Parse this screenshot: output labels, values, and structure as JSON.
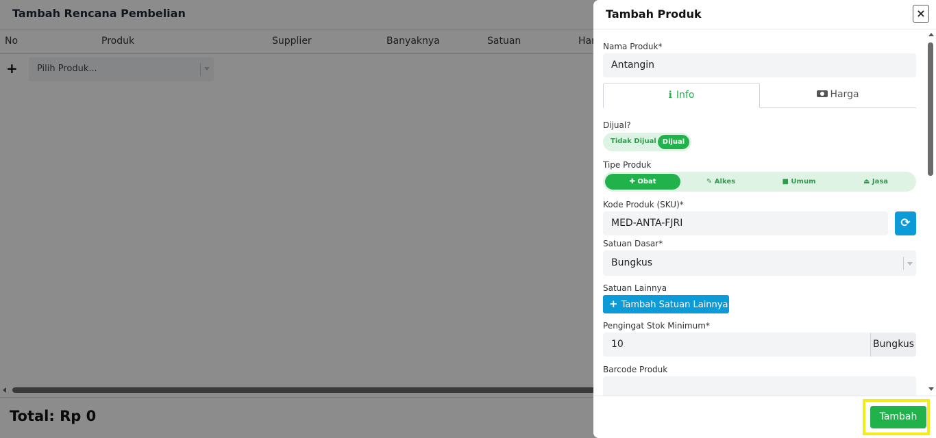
{
  "background": {
    "title": "Tambah Rencana Pembelian",
    "table_headers": [
      "No",
      "Produk",
      "Supplier",
      "Banyaknya",
      "Satuan",
      "Har"
    ],
    "product_select_placeholder": "Pilih Produk...",
    "total_label": "Total: Rp 0"
  },
  "drawer": {
    "title": "Tambah Produk",
    "close_label": "×",
    "nama_produk": {
      "label": "Nama Produk*",
      "value": "Antangin"
    },
    "tabs": [
      {
        "label": "Info",
        "icon": "info-icon"
      },
      {
        "label": "Harga",
        "icon": "money-icon"
      }
    ],
    "dijual": {
      "label": "Dijual?",
      "options": [
        "Tidak Dijual",
        "Dijual"
      ],
      "selected": "Dijual"
    },
    "tipe_produk": {
      "label": "Tipe Produk",
      "options": [
        {
          "label": "Obat",
          "icon": "pills-icon"
        },
        {
          "label": "Alkes",
          "icon": "pencil-icon"
        },
        {
          "label": "Umum",
          "icon": "box-icon"
        },
        {
          "label": "Jasa",
          "icon": "eject-icon"
        }
      ],
      "selected": "Obat"
    },
    "kode_produk": {
      "label": "Kode Produk (SKU)*",
      "value": "MED-ANTA-FJRI"
    },
    "satuan_dasar": {
      "label": "Satuan Dasar*",
      "value": "Bungkus"
    },
    "satuan_lainnya": {
      "label": "Satuan Lainnya",
      "button_label": "Tambah Satuan Lainnya"
    },
    "stok_minimum": {
      "label": "Pengingat Stok Minimum*",
      "value": "10",
      "unit": "Bungkus"
    },
    "barcode": {
      "label": "Barcode Produk",
      "value": ""
    },
    "submit_label": "Tambah"
  },
  "colors": {
    "accent_green": "#22b24c",
    "accent_blue": "#0c9bd6",
    "highlight_yellow": "#f2ec1a"
  }
}
